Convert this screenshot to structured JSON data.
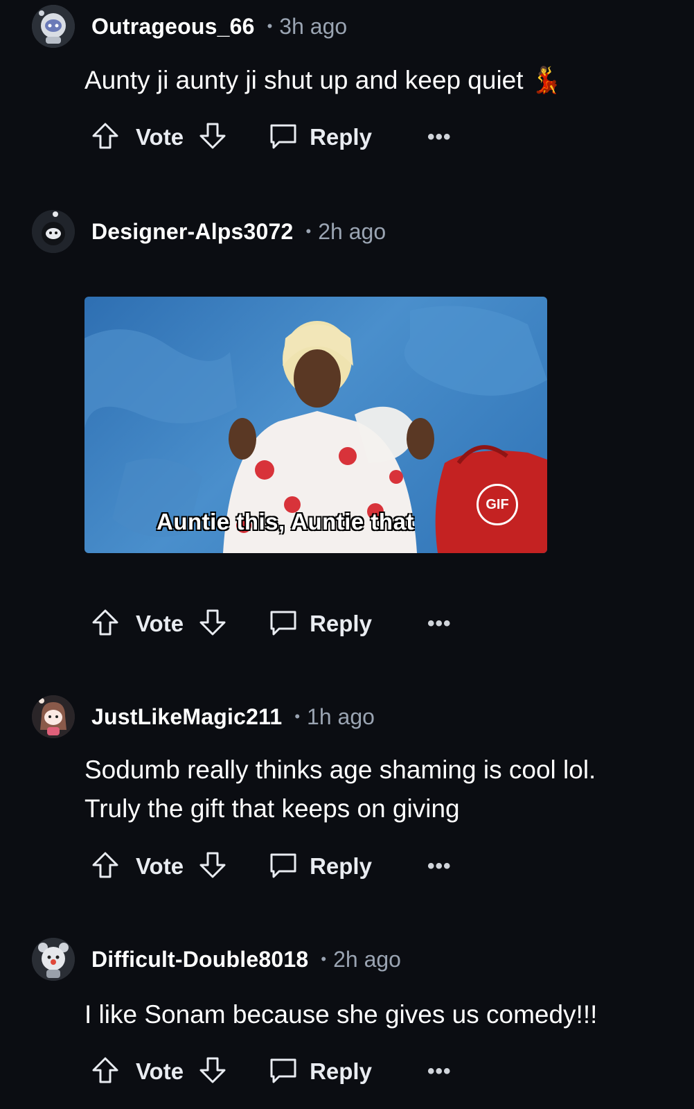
{
  "comments": [
    {
      "username": "Outrageous_66",
      "separator": "•",
      "time": "3h ago",
      "text": "Aunty ji aunty ji shut up and keep quiet 💃",
      "avatar": "snoo-astronaut-avatar",
      "actions": {
        "vote": "Vote",
        "reply": "Reply",
        "more": "•••"
      }
    },
    {
      "username": "Designer-Alps3072",
      "separator": "•",
      "time": "2h ago",
      "gif": {
        "caption": "Auntie this, Auntie that",
        "badge": "GIF"
      },
      "avatar": "snoo-panda-avatar",
      "actions": {
        "vote": "Vote",
        "reply": "Reply",
        "more": "•••"
      }
    },
    {
      "username": "JustLikeMagic211",
      "separator": "•",
      "time": "1h ago",
      "text_lines": [
        "Sodumb really thinks age shaming is cool lol.",
        "Truly the gift that keeps on giving"
      ],
      "avatar": "snoo-girl-avatar",
      "actions": {
        "vote": "Vote",
        "reply": "Reply",
        "more": "•••"
      }
    },
    {
      "username": "Difficult-Double8018",
      "separator": "•",
      "time": "2h ago",
      "text": "I like Sonam because she gives us comedy!!!",
      "avatar": "snoo-bear-avatar",
      "actions": {
        "vote": "Vote",
        "reply": "Reply",
        "more": "•••"
      }
    }
  ],
  "colors": {
    "background": "#0b0d12",
    "muted": "#9aa4b2",
    "text": "#ffffff"
  }
}
